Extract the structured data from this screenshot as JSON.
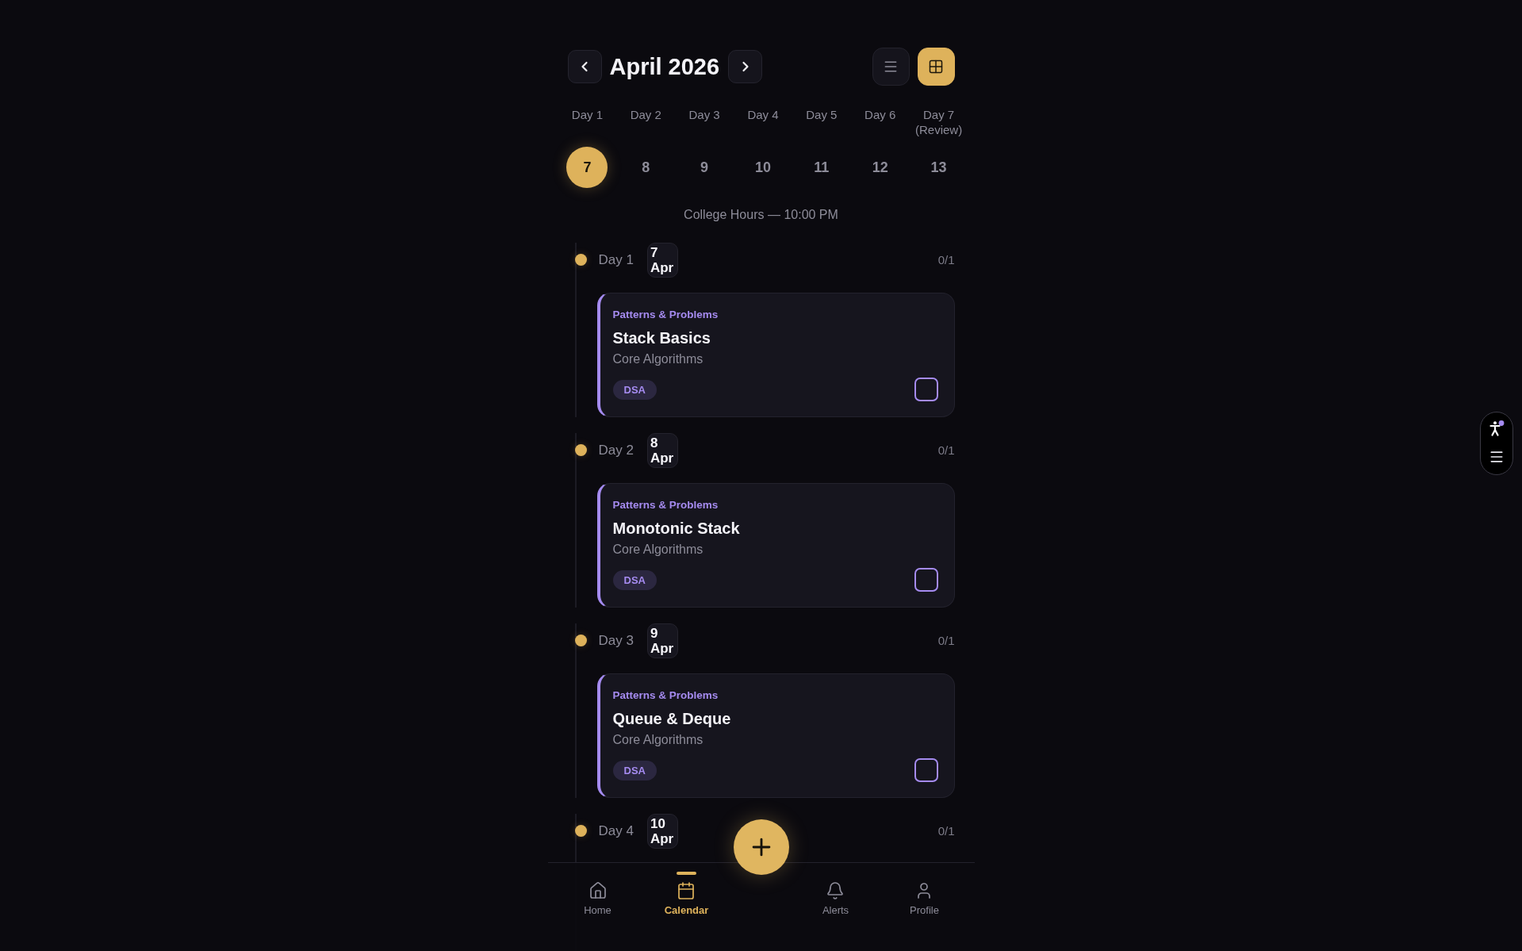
{
  "header": {
    "title": "April 2026",
    "view_toggle": [
      {
        "kind": "list",
        "selected": false
      },
      {
        "kind": "grid",
        "selected": true
      }
    ]
  },
  "week": [
    {
      "label": "Day 1",
      "date": "7",
      "selected": true
    },
    {
      "label": "Day 2",
      "date": "8",
      "selected": false
    },
    {
      "label": "Day 3",
      "date": "9",
      "selected": false
    },
    {
      "label": "Day 4",
      "date": "10",
      "selected": false
    },
    {
      "label": "Day 5",
      "date": "11",
      "selected": false
    },
    {
      "label": "Day 6",
      "date": "12",
      "selected": false
    },
    {
      "label": "Day 7 (Review)",
      "date": "13",
      "selected": false
    }
  ],
  "schedule_note": "College Hours — 10:00 PM",
  "timeline": [
    {
      "label": "Day 1",
      "date": "7 Apr",
      "progress": "0/1",
      "tasks": [
        {
          "category": "Patterns & Problems",
          "title": "Stack Basics",
          "subtitle": "Core Algorithms",
          "tag": "DSA",
          "checked": false
        }
      ]
    },
    {
      "label": "Day 2",
      "date": "8 Apr",
      "progress": "0/1",
      "tasks": [
        {
          "category": "Patterns & Problems",
          "title": "Monotonic Stack",
          "subtitle": "Core Algorithms",
          "tag": "DSA",
          "checked": false
        }
      ]
    },
    {
      "label": "Day 3",
      "date": "9 Apr",
      "progress": "0/1",
      "tasks": [
        {
          "category": "Patterns & Problems",
          "title": "Queue & Deque",
          "subtitle": "Core Algorithms",
          "tag": "DSA",
          "checked": false
        }
      ]
    },
    {
      "label": "Day 4",
      "date": "10 Apr",
      "progress": "0/1"
    }
  ],
  "bottom_nav": {
    "items": [
      {
        "kind": "home",
        "label": "Home",
        "selected": false
      },
      {
        "kind": "calendar",
        "label": "Calendar",
        "selected": true
      },
      {
        "kind": "alerts",
        "label": "Alerts",
        "selected": false
      },
      {
        "kind": "profile",
        "label": "Profile",
        "selected": false
      }
    ]
  }
}
